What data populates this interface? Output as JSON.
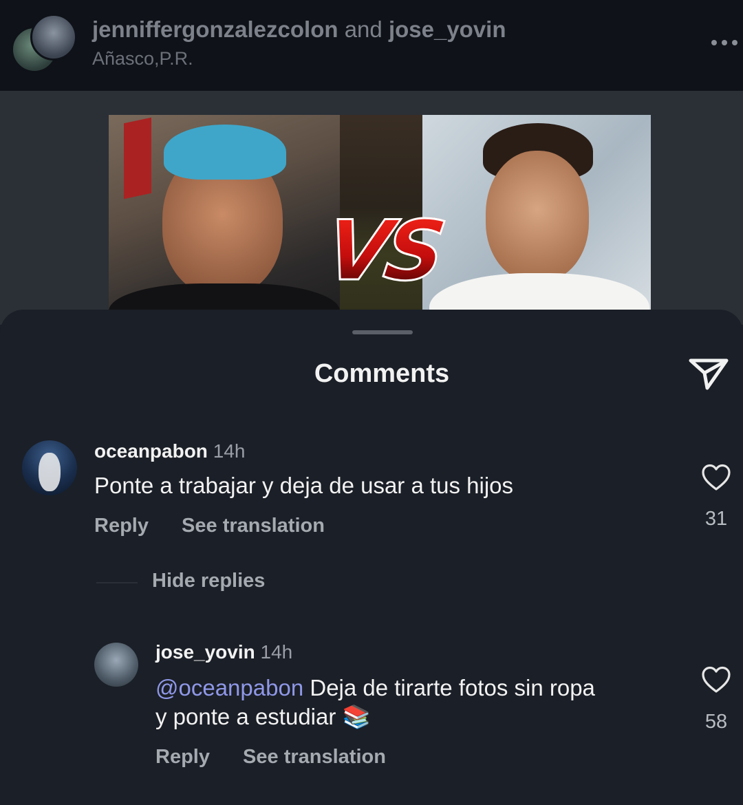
{
  "post": {
    "user1": "jenniffergonzalezcolon",
    "connector": "and",
    "user2": "jose_yovin",
    "location": "Añasco,P.R.",
    "vs_text": "VS"
  },
  "sheet": {
    "title": "Comments"
  },
  "comments": [
    {
      "username": "oceanpabon",
      "time": "14h",
      "text": "Ponte a trabajar y deja de usar a tus hijos",
      "reply_label": "Reply",
      "translate_label": "See translation",
      "likes": "31",
      "hide_replies_label": "Hide replies"
    },
    {
      "username": "jose_yovin",
      "time": "14h",
      "mention": "@oceanpabon",
      "text": " Deja de tirarte fotos sin ropa",
      "text_line2": "y ponte a estudiar 📚",
      "reply_label": "Reply",
      "translate_label": "See translation",
      "likes": "58"
    }
  ]
}
